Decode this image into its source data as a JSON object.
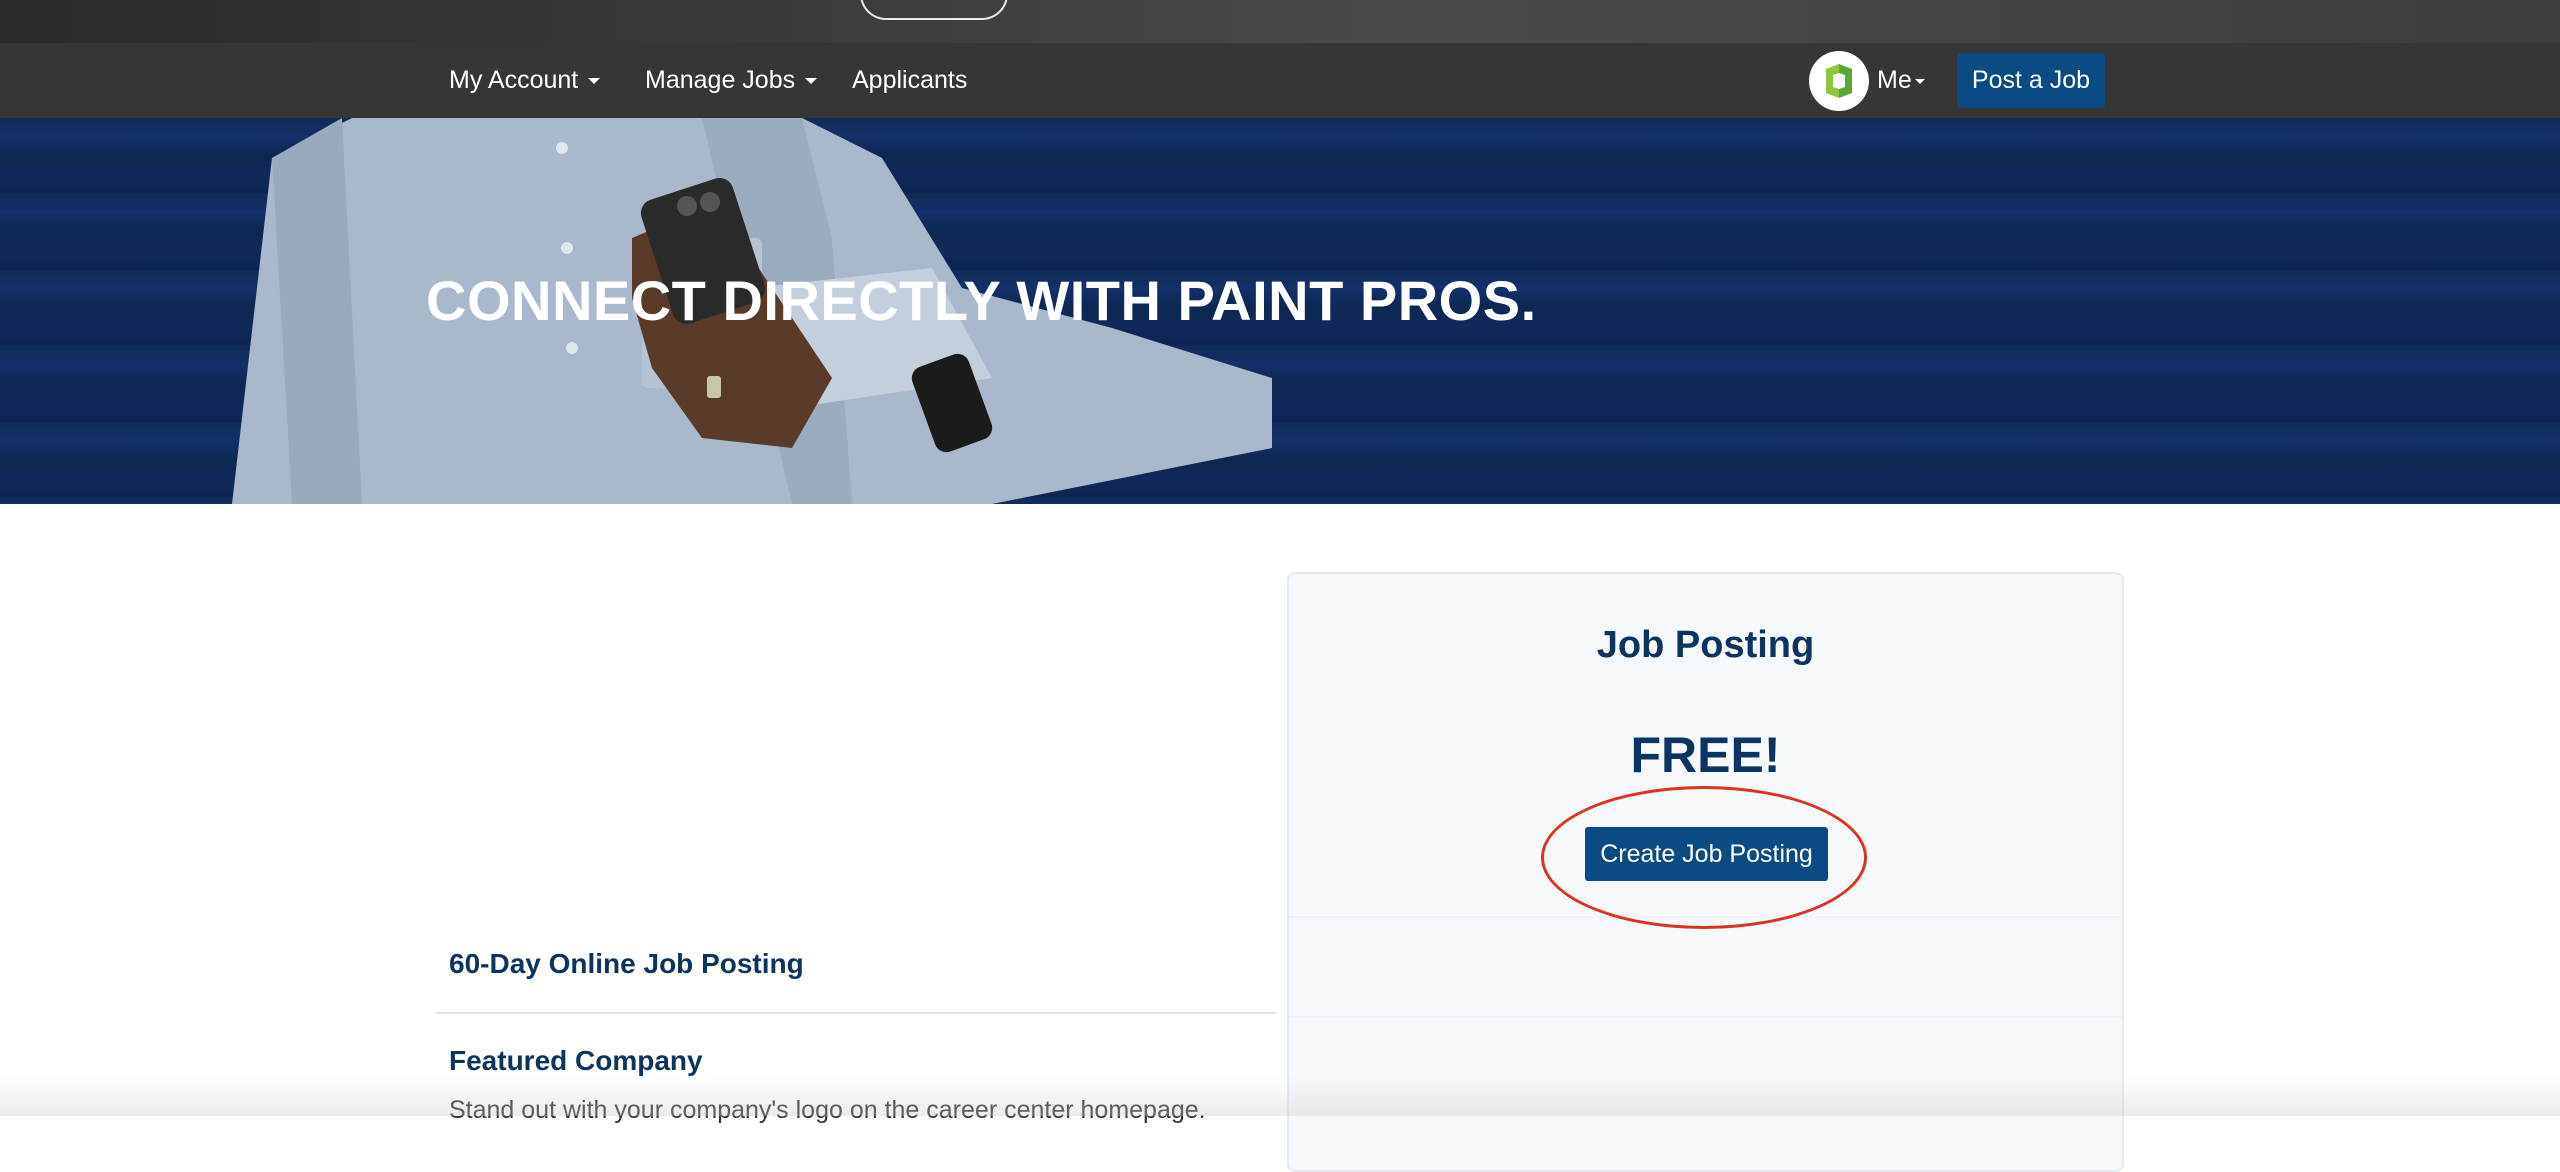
{
  "nav": {
    "my_account_label": "My Account",
    "manage_jobs_label": "Manage Jobs",
    "applicants_label": "Applicants",
    "me_label": "Me",
    "post_job_label": "Post a Job"
  },
  "hero": {
    "title": "CONNECT DIRECTLY WITH PAINT PROS."
  },
  "features": {
    "items": [
      {
        "title": "60-Day Online Job Posting"
      },
      {
        "title": "Featured Company",
        "description": "Stand out with your company's logo on the career center homepage."
      }
    ]
  },
  "pricing_card": {
    "title": "Job Posting",
    "price": "FREE!",
    "cta_label": "Create Job Posting"
  },
  "colors": {
    "brand_navy": "#0d3460",
    "button_blue": "#0b4a82",
    "nav_background": "#363636",
    "hero_background": "#0f2b57",
    "highlight_red": "#e0301e",
    "avatar_green": "#8dc63f"
  },
  "icons": {
    "avatar": "company-logo-icon",
    "dropdown": "caret-down-icon"
  }
}
